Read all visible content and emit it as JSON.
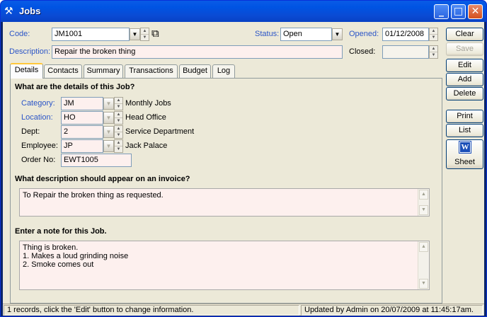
{
  "window": {
    "title": "Jobs"
  },
  "header": {
    "code_label": "Code:",
    "code_value": "JM1001",
    "status_label": "Status:",
    "status_value": "Open",
    "opened_label": "Opened:",
    "opened_value": "01/12/2008",
    "description_label": "Description:",
    "description_value": "Repair the broken thing",
    "closed_label": "Closed:",
    "closed_value": ""
  },
  "tabs": [
    {
      "label": "Details",
      "active": true
    },
    {
      "label": "Contacts"
    },
    {
      "label": "Summary"
    },
    {
      "label": "Transactions"
    },
    {
      "label": "Budget"
    },
    {
      "label": "Log"
    }
  ],
  "details": {
    "heading": "What are the details of this Job?",
    "fields": [
      {
        "label": "Category:",
        "code": "JM",
        "name": "Monthly Jobs"
      },
      {
        "label": "Location:",
        "code": "HO",
        "name": "Head Office"
      },
      {
        "label": "Dept:",
        "code": "2",
        "name": "Service Department"
      },
      {
        "label": "Employee:",
        "code": "JP",
        "name": "Jack Palace"
      }
    ],
    "order_label": "Order No:",
    "order_value": "EWT1005",
    "invoice_heading": "What description should appear on an invoice?",
    "invoice_text": "To Repair the broken thing as requested.",
    "note_heading": "Enter a note for this Job.",
    "note_lines": [
      "Thing is broken.",
      "1. Makes a loud grinding noise",
      "2. Smoke comes out"
    ]
  },
  "buttons": {
    "clear": "Clear",
    "save": "Save",
    "edit": "Edit",
    "add": "Add",
    "delete": "Delete",
    "print": "Print",
    "list": "List",
    "sheet": "Sheet",
    "word_glyph": "W"
  },
  "statusbar": {
    "left": "1 records, click the 'Edit' button to change information.",
    "right": "Updated by Admin on 20/07/2009 at 11:45:17am."
  },
  "colors": {
    "accent": "#2b55c7",
    "field_pink": "#fdf0ee",
    "titlebar": "#0054e3"
  },
  "icons": [
    "tools-icon",
    "binoculars-icon",
    "word-icon",
    "minimize-icon",
    "maximize-icon",
    "close-icon"
  ]
}
